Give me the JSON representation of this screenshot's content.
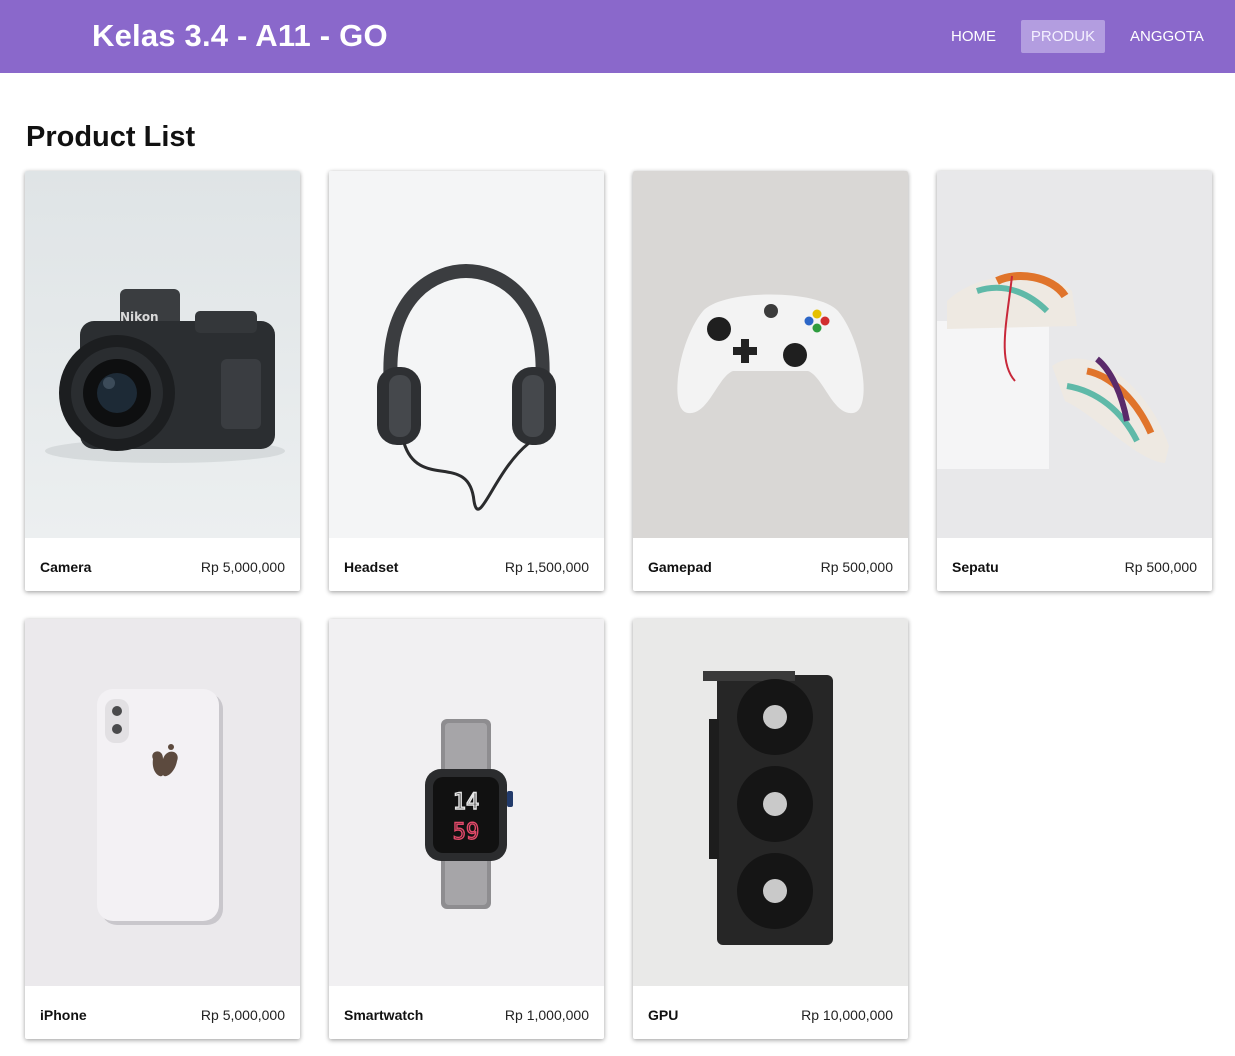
{
  "header": {
    "brand": "Kelas 3.4 - A11 - GO",
    "nav": [
      {
        "label": "HOME",
        "active": false
      },
      {
        "label": "PRODUK",
        "active": true
      },
      {
        "label": "ANGGOTA",
        "active": false
      }
    ],
    "colors": {
      "navbar": "#8a68cb",
      "active_item": "#b39de0"
    }
  },
  "main": {
    "title": "Product List",
    "products": [
      {
        "name": "Camera",
        "price": "Rp 5,000,000",
        "image": "camera-photo"
      },
      {
        "name": "Headset",
        "price": "Rp 1,500,000",
        "image": "headset-photo"
      },
      {
        "name": "Gamepad",
        "price": "Rp 500,000",
        "image": "gamepad-photo"
      },
      {
        "name": "Sepatu",
        "price": "Rp 500,000",
        "image": "sneakers-photo"
      },
      {
        "name": "iPhone",
        "price": "Rp 5,000,000",
        "image": "iphone-photo"
      },
      {
        "name": "Smartwatch",
        "price": "Rp 1,000,000",
        "image": "smartwatch-photo"
      },
      {
        "name": "GPU",
        "price": "Rp 10,000,000",
        "image": "gpu-photo"
      }
    ]
  }
}
